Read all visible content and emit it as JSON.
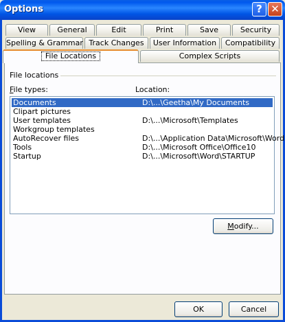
{
  "window": {
    "title": "Options"
  },
  "titlebar_buttons": {
    "help": "?",
    "close": "✕"
  },
  "tabs": {
    "row1": [
      "View",
      "General",
      "Edit",
      "Print",
      "Save",
      "Security"
    ],
    "row2": [
      "Spelling & Grammar",
      "Track Changes",
      "User Information",
      "Compatibility"
    ],
    "row3": [
      "File Locations",
      "Complex Scripts"
    ],
    "active": "File Locations"
  },
  "group": {
    "label": "File locations",
    "col_file_types_hotkey": "F",
    "col_file_types_rest": "ile types:",
    "col_location": "Location:"
  },
  "rows": [
    {
      "file_type": "Documents",
      "location": "D:\\...\\Geetha\\My Documents",
      "selected": true
    },
    {
      "file_type": "Clipart pictures",
      "location": ""
    },
    {
      "file_type": "User templates",
      "location": "D:\\...\\Microsoft\\Templates"
    },
    {
      "file_type": "Workgroup templates",
      "location": ""
    },
    {
      "file_type": "AutoRecover files",
      "location": "D:\\...\\Application Data\\Microsoft\\Word"
    },
    {
      "file_type": "Tools",
      "location": "D:\\...\\Microsoft Office\\Office10"
    },
    {
      "file_type": "Startup",
      "location": "D:\\...\\Microsoft\\Word\\STARTUP"
    }
  ],
  "buttons": {
    "modify_hotkey": "M",
    "modify_rest": "odify...",
    "ok": "OK",
    "cancel": "Cancel"
  },
  "colors": {
    "titlebar": "#0055e5",
    "selection": "#316ac5",
    "active_tab_accent": "#e68b2c"
  }
}
